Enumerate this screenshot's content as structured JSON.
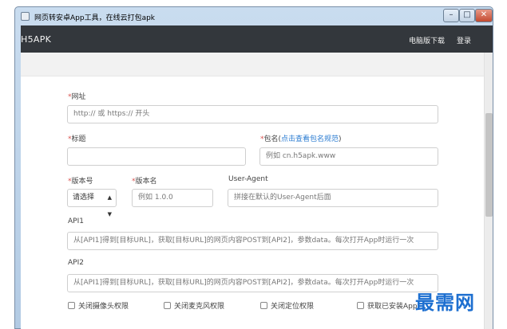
{
  "window": {
    "title": "网页转安卓App工具，在线云打包apk",
    "minimize_glyph": "–",
    "maximize_glyph": "□",
    "close_glyph": "✕"
  },
  "navbar": {
    "brand": "H5APK",
    "links": [
      "电脑版下载",
      "登录"
    ]
  },
  "form": {
    "required_mark": "*",
    "url": {
      "label": "网址",
      "placeholder": "http:// 或 https:// 开头"
    },
    "title": {
      "label": "标题",
      "value": ""
    },
    "package": {
      "label_prefix": "包名(",
      "label_link": "点击查看包名规范",
      "label_suffix": ")",
      "placeholder": "例如 cn.h5apk.www"
    },
    "version_code": {
      "label": "版本号",
      "selected": "请选择"
    },
    "version_name": {
      "label": "版本名",
      "placeholder": "例如 1.0.0"
    },
    "user_agent": {
      "label": "User-Agent",
      "placeholder": "拼接在默认的User-Agent后面"
    },
    "api1": {
      "label": "API1",
      "placeholder": "从[API1]得到[目标URL]，获取[目标URL]的网页内容POST到[API2]，参数data。每次打开App时运行一次"
    },
    "api2": {
      "label": "API2",
      "placeholder": "从[API1]得到[目标URL]，获取[目标URL]的网页内容POST到[API2]，参数data。每次打开App时运行一次"
    },
    "checkboxes": [
      "关闭摄像头权限",
      "关闭麦克风权限",
      "关闭定位权限",
      "获取已安装App"
    ]
  },
  "watermark": "最需网",
  "colors": {
    "navbar_bg": "#33373c",
    "required": "#d9534f",
    "link": "#2a7bd1",
    "watermark": "#1d6fd0"
  },
  "icons": {
    "app_icon": "app-window-icon",
    "select_arrow": "select-updown-arrow-icon"
  }
}
